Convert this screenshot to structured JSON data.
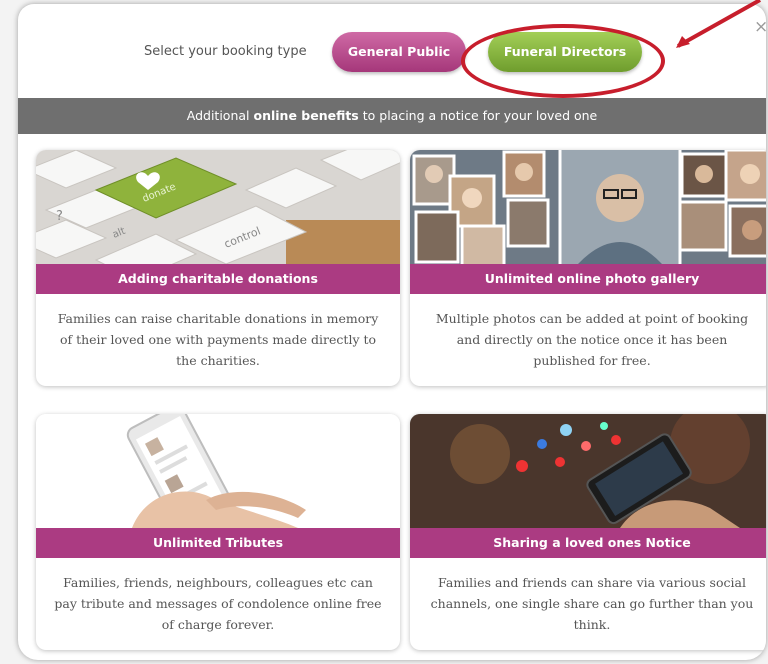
{
  "modal": {
    "select_label": "Select your booking type",
    "buttons": {
      "general_public": "General Public",
      "funeral_directors": "Funeral Directors"
    },
    "close_icon": "×",
    "banner": {
      "prefix": "Additional ",
      "bold": "online benefits",
      "suffix": " to placing a notice for your loved one"
    }
  },
  "cards": [
    {
      "title": "Adding charitable donations",
      "description": "Families can raise charitable donations in memory of their loved one with payments made directly to the charities.",
      "image_text": "donate"
    },
    {
      "title": "Unlimited online photo gallery",
      "description": "Multiple photos can be added at point of booking and directly on the notice once it has been published for free."
    },
    {
      "title": "Unlimited Tributes",
      "description": "Families, friends, neighbours, colleagues etc can pay tribute and messages of condolence online free of charge forever."
    },
    {
      "title": "Sharing a loved ones Notice",
      "description": "Families and friends can share via various social channels, one single share can go further than you think."
    }
  ],
  "colors": {
    "purple": "#ab3b82",
    "green": "#86b63e",
    "banner_gray": "#6f6f6f",
    "annotation_red": "#c71e2c"
  },
  "icons": [
    "close-icon",
    "annotation-arrow"
  ]
}
